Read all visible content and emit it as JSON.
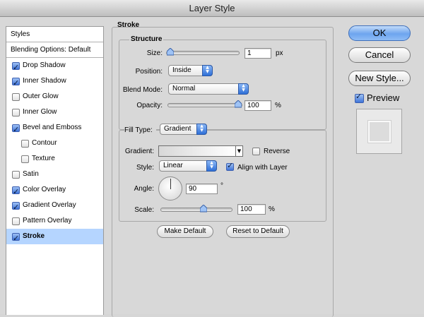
{
  "window": {
    "title": "Layer Style"
  },
  "styles_panel": {
    "header": "Styles",
    "items": [
      {
        "label": "Blending Options: Default",
        "checkbox": false,
        "checked": false,
        "indent": 0,
        "selected": false
      },
      {
        "label": "Drop Shadow",
        "checkbox": true,
        "checked": true,
        "indent": 0,
        "selected": false
      },
      {
        "label": "Inner Shadow",
        "checkbox": true,
        "checked": true,
        "indent": 0,
        "selected": false
      },
      {
        "label": "Outer Glow",
        "checkbox": true,
        "checked": false,
        "indent": 0,
        "selected": false
      },
      {
        "label": "Inner Glow",
        "checkbox": true,
        "checked": false,
        "indent": 0,
        "selected": false
      },
      {
        "label": "Bevel and Emboss",
        "checkbox": true,
        "checked": true,
        "indent": 0,
        "selected": false
      },
      {
        "label": "Contour",
        "checkbox": true,
        "checked": false,
        "indent": 1,
        "selected": false
      },
      {
        "label": "Texture",
        "checkbox": true,
        "checked": false,
        "indent": 1,
        "selected": false
      },
      {
        "label": "Satin",
        "checkbox": true,
        "checked": false,
        "indent": 0,
        "selected": false
      },
      {
        "label": "Color Overlay",
        "checkbox": true,
        "checked": true,
        "indent": 0,
        "selected": false
      },
      {
        "label": "Gradient Overlay",
        "checkbox": true,
        "checked": true,
        "indent": 0,
        "selected": false
      },
      {
        "label": "Pattern Overlay",
        "checkbox": true,
        "checked": false,
        "indent": 0,
        "selected": false
      },
      {
        "label": "Stroke",
        "checkbox": true,
        "checked": true,
        "indent": 0,
        "selected": true
      }
    ]
  },
  "stroke": {
    "section_title": "Stroke",
    "structure": {
      "title": "Structure",
      "size_label": "Size:",
      "size_value": "1",
      "size_unit": "px",
      "size_slider_fraction": 0.02,
      "position_label": "Position:",
      "position_value": "Inside",
      "blend_mode_label": "Blend Mode:",
      "blend_mode_value": "Normal",
      "opacity_label": "Opacity:",
      "opacity_value": "100",
      "opacity_unit": "%",
      "opacity_slider_fraction": 1.0
    },
    "fill": {
      "fill_type_label": "Fill Type:",
      "fill_type_value": "Gradient",
      "gradient_label": "Gradient:",
      "reverse_label": "Reverse",
      "reverse_checked": false,
      "style_label": "Style:",
      "style_value": "Linear",
      "align_label": "Align with Layer",
      "align_checked": true,
      "angle_label": "Angle:",
      "angle_value": "90",
      "angle_unit": "°",
      "scale_label": "Scale:",
      "scale_value": "100",
      "scale_unit": "%",
      "scale_slider_fraction": 0.62
    },
    "make_default_label": "Make Default",
    "reset_default_label": "Reset to Default"
  },
  "actions": {
    "ok_label": "OK",
    "cancel_label": "Cancel",
    "new_style_label": "New Style...",
    "preview_label": "Preview",
    "preview_checked": true
  },
  "colors": {
    "selection": "#b5d5ff",
    "accent": "#3f74d8"
  }
}
